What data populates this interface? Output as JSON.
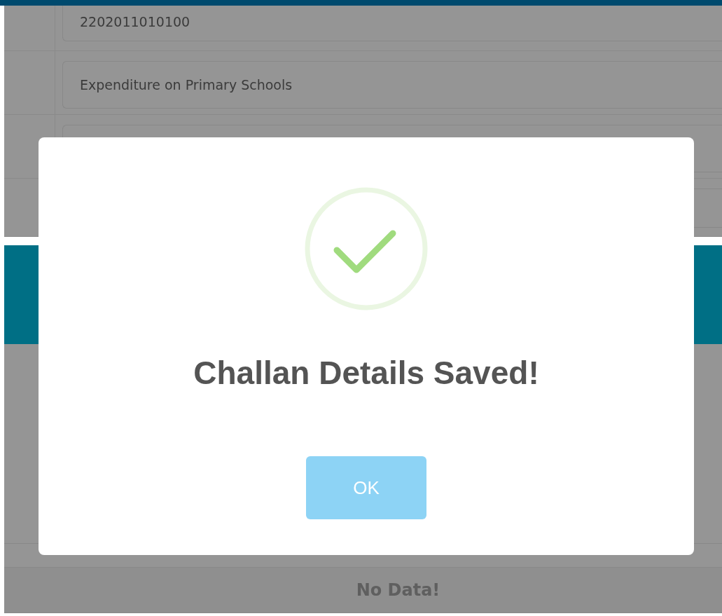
{
  "form": {
    "fields": [
      {
        "value": "2202011010100"
      },
      {
        "value": "Expenditure on Primary Schools"
      }
    ]
  },
  "table": {
    "empty_text": "No Data!"
  },
  "dialog": {
    "title": "Challan Details Saved!",
    "button": "OK"
  }
}
